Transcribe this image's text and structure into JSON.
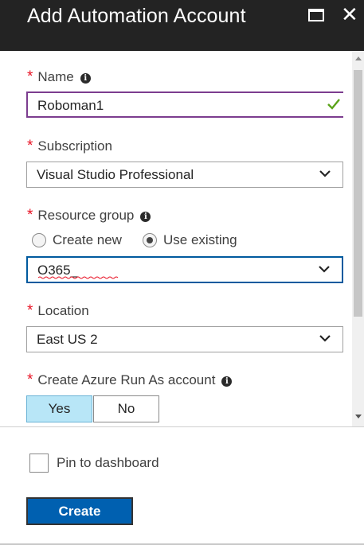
{
  "header": {
    "title": "Add Automation Account"
  },
  "form": {
    "name": {
      "label": "Name",
      "value": "Roboman1",
      "valid": true
    },
    "subscription": {
      "label": "Subscription",
      "value": "Visual Studio Professional"
    },
    "resource_group": {
      "label": "Resource group",
      "option_create_new": "Create new",
      "option_use_existing": "Use existing",
      "selected_option": "Use existing",
      "value": "O365_"
    },
    "location": {
      "label": "Location",
      "value": "East US 2"
    },
    "run_as": {
      "label": "Create Azure Run As account",
      "yes_label": "Yes",
      "no_label": "No",
      "selected": "Yes"
    }
  },
  "footer": {
    "pin_label": "Pin to dashboard",
    "pin_checked": false,
    "create_label": "Create"
  },
  "colors": {
    "header_bg": "#232323",
    "required": "#e81123",
    "name_border": "#7c3d8f",
    "valid_check": "#5ba31a",
    "focus_border": "#005a9e",
    "selected_toggle": "#b8e6f7",
    "primary_button": "#0060b0"
  }
}
